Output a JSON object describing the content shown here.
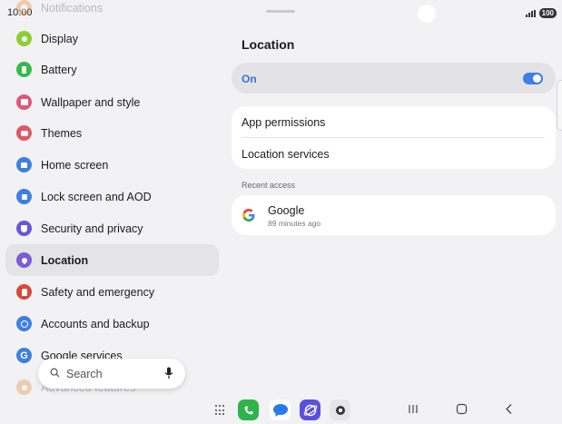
{
  "status_bar": {
    "time": "10:00",
    "battery": "100"
  },
  "sidebar": {
    "items": [
      {
        "label": "Notifications",
        "icon": "bell-icon",
        "color": "#e0883a"
      },
      {
        "label": "Display",
        "icon": "sun-icon",
        "color": "#8ccf35"
      },
      {
        "label": "Battery",
        "icon": "battery-icon",
        "color": "#38b84a"
      },
      {
        "label": "Wallpaper and style",
        "icon": "wallpaper-icon",
        "color": "#e25577"
      },
      {
        "label": "Themes",
        "icon": "themes-icon",
        "color": "#e05565"
      },
      {
        "label": "Home screen",
        "icon": "home-icon",
        "color": "#3f7fe0"
      },
      {
        "label": "Lock screen and AOD",
        "icon": "lock-icon",
        "color": "#3f7fe0"
      },
      {
        "label": "Security and privacy",
        "icon": "shield-icon",
        "color": "#6a55d8"
      },
      {
        "label": "Location",
        "icon": "location-pin-icon",
        "color": "#7a5cd8"
      },
      {
        "label": "Safety and emergency",
        "icon": "emergency-icon",
        "color": "#d9473a"
      },
      {
        "label": "Accounts and backup",
        "icon": "sync-icon",
        "color": "#3f7fe0"
      },
      {
        "label": "Google services",
        "icon": "google-icon",
        "color": "#3f7fe0"
      },
      {
        "label": "Advanced features",
        "icon": "gear-plus-icon",
        "color": "#e0883a"
      }
    ]
  },
  "search": {
    "label": "Search"
  },
  "location": {
    "title": "Location",
    "toggle_label": "On",
    "toggle_on": true,
    "options": [
      "App permissions",
      "Location services"
    ],
    "recent_header": "Recent access",
    "recent": [
      {
        "name": "Google",
        "time": "89 minutes ago"
      }
    ]
  },
  "taskbar": {
    "apps": [
      "apps-grid-icon",
      "phone-app-icon",
      "messages-app-icon",
      "internet-app-icon",
      "camera-app-icon"
    ],
    "nav": [
      "recents-button",
      "home-button",
      "back-button"
    ]
  }
}
